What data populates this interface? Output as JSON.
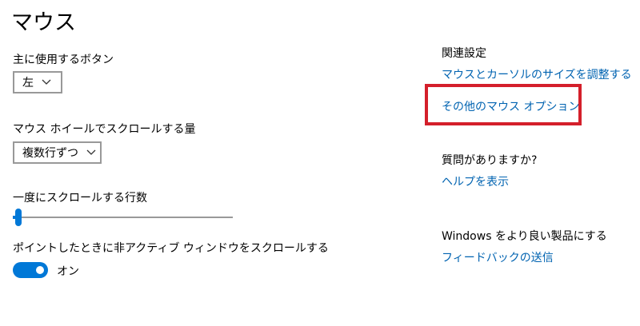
{
  "page": {
    "title": "マウス"
  },
  "primary_button": {
    "label": "主に使用するボタン",
    "value": "左"
  },
  "wheel_scroll": {
    "label": "マウス ホイールでスクロールする量",
    "value": "複数行ずつ"
  },
  "lines_to_scroll": {
    "label": "一度にスクロールする行数",
    "slider_fraction": 0.02
  },
  "inactive_scroll": {
    "label": "ポイントしたときに非アクティブ ウィンドウをスクロールする",
    "toggle_state": "オン"
  },
  "related_settings": {
    "heading": "関連設定",
    "links": [
      "マウスとカーソルのサイズを調整する",
      "その他のマウス オプション"
    ]
  },
  "questions": {
    "heading": "質問がありますか?",
    "link": "ヘルプを表示"
  },
  "feedback": {
    "heading": "Windows をより良い製品にする",
    "link": "フィードバックの送信"
  },
  "colors": {
    "accent": "#0078d7",
    "link": "#0063b1",
    "highlight": "#d41f2b",
    "border": "#999999"
  },
  "icons": {
    "dropdown_arrow": "chevron-down-icon"
  }
}
